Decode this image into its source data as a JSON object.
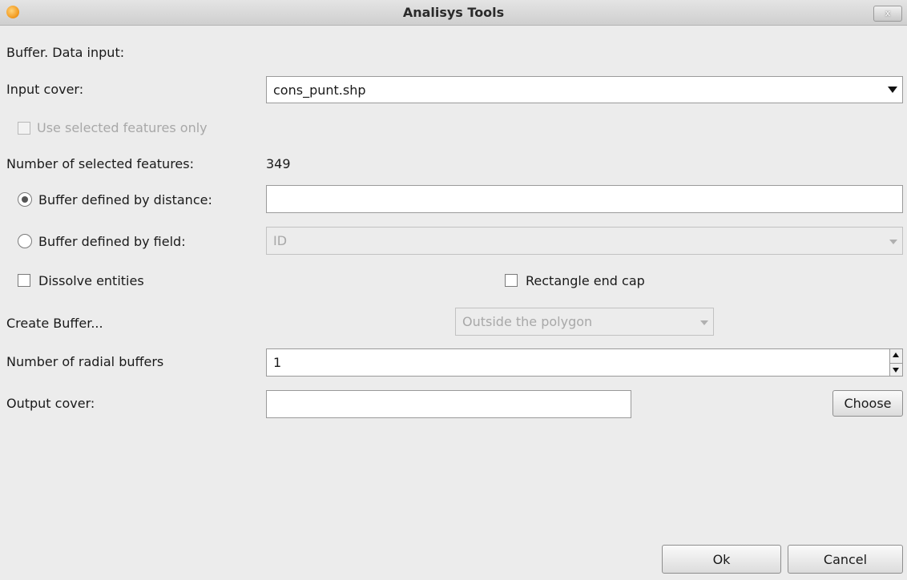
{
  "window": {
    "title": "Analisys Tools",
    "close_label": "x"
  },
  "form": {
    "section_title": "Buffer. Data input:",
    "input_cover_label": "Input cover:",
    "input_cover_value": "cons_punt.shp",
    "use_selected_label": "Use selected features only",
    "use_selected_checked": false,
    "num_selected_label": "Number of selected features:",
    "num_selected_value": "349",
    "buffer_distance_label": "Buffer defined by distance:",
    "buffer_distance_selected": true,
    "buffer_distance_value": "",
    "buffer_field_label": "Buffer defined by field:",
    "buffer_field_value": "ID",
    "dissolve_label": "Dissolve entities",
    "rect_endcap_label": "Rectangle end cap",
    "create_buffer_label": "Create Buffer...",
    "create_buffer_value": "Outside the polygon",
    "radial_label": "Number of radial buffers",
    "radial_value": "1",
    "output_label": "Output cover:",
    "output_value": "",
    "choose_label": "Choose"
  },
  "buttons": {
    "ok": "Ok",
    "cancel": "Cancel"
  },
  "icons": {
    "app": "app-logo-icon",
    "close": "close-icon"
  }
}
